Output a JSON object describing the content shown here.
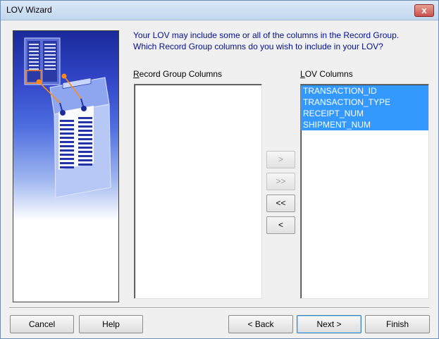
{
  "window": {
    "title": "LOV Wizard",
    "close_glyph": "x"
  },
  "question": {
    "line1": "Your LOV may include some or all of the columns in the Record Group.",
    "line2": "Which Record Group columns do you wish to include in your LOV?"
  },
  "record_group": {
    "label_first": "R",
    "label_rest": "ecord Group Columns",
    "items": []
  },
  "lov": {
    "label_first": "L",
    "label_rest": "OV Columns",
    "items": [
      "TRANSACTION_ID",
      "TRANSACTION_TYPE",
      "RECEIPT_NUM",
      "SHIPMENT_NUM"
    ]
  },
  "move_buttons": {
    "move_one": ">",
    "move_all": ">>",
    "remove_all": "<<",
    "remove_one": "<"
  },
  "buttons": {
    "cancel": "Cancel",
    "help": "Help",
    "back": "< Back",
    "next": "Next >",
    "finish": "Finish"
  },
  "colors": {
    "question_text": "#00108f",
    "selection": "#3399ff"
  }
}
